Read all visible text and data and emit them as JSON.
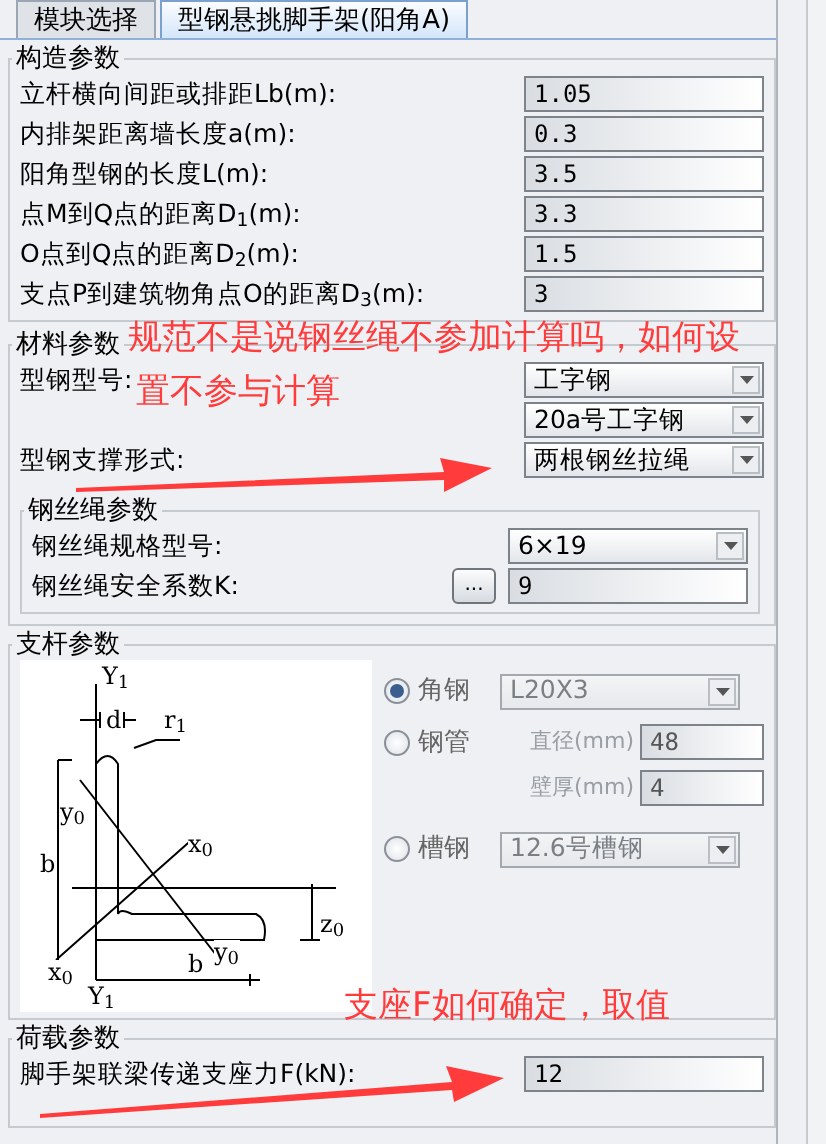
{
  "tabs": [
    {
      "label": "模块选择",
      "selected": false
    },
    {
      "label": "型钢悬挑脚手架(阳角A)",
      "selected": true
    }
  ],
  "construction": {
    "title": "构造参数",
    "fields": [
      {
        "label": "立杆横向间距或排距Lb(m):",
        "value": "1.05"
      },
      {
        "label": "内排架距离墙长度a(m):",
        "value": "0.3"
      },
      {
        "label": "阳角型钢的长度L(m):",
        "value": "3.5"
      },
      {
        "label": "点M到Q点的距离D$_{1}$(m):",
        "value": "3.3"
      },
      {
        "label": "O点到Q点的距离D$_{2}$(m):",
        "value": "1.5"
      },
      {
        "label": "支点P到建筑物角点O的距离D$_{3}$(m):",
        "value": "3"
      }
    ]
  },
  "material": {
    "title": "材料参数",
    "rows": [
      {
        "label": "型钢型号:",
        "value": "工字钢"
      },
      {
        "value": "20a号工字钢"
      },
      {
        "label": "型钢支撑形式:",
        "value": "两根钢丝拉绳"
      }
    ]
  },
  "wire_rope": {
    "title": "钢丝绳参数",
    "rows": [
      {
        "kind": "select",
        "label": "钢丝绳规格型号:",
        "value": "6×19"
      },
      {
        "kind": "input",
        "label": "钢丝绳安全系数K:",
        "button": "...",
        "value": "9"
      }
    ]
  },
  "strut": {
    "title": "支杆参数",
    "diagram_labels": [
      "Y$_{1}$",
      "d",
      "r$_{1}$",
      "y$_{0}$",
      "x$_{0}$",
      "b",
      "z$_{0}$",
      "y$_{0}$",
      "b",
      "x$_{0}$",
      "Y$_{1}$"
    ],
    "options": [
      {
        "label": "角钢",
        "selected": true,
        "disabled": true,
        "select": "L20X3"
      },
      {
        "label": "钢管",
        "selected": false,
        "disabled": true,
        "fields": [
          {
            "label": "直径(mm)",
            "value": "48"
          },
          {
            "label": "壁厚(mm)",
            "value": "4"
          }
        ]
      },
      {
        "label": "槽钢",
        "selected": false,
        "disabled": true,
        "select": "12.6号槽钢"
      }
    ]
  },
  "load": {
    "title": "荷载参数",
    "fields": [
      {
        "label": "脚手架联梁传递支座力F(kN):",
        "value": "12"
      }
    ]
  },
  "annotations": [
    {
      "text": "规范不是说钢丝绳不参加计算吗，如何设"
    },
    {
      "text": "置不参与计算"
    },
    {
      "text": "支座F如何确定，取值"
    }
  ]
}
